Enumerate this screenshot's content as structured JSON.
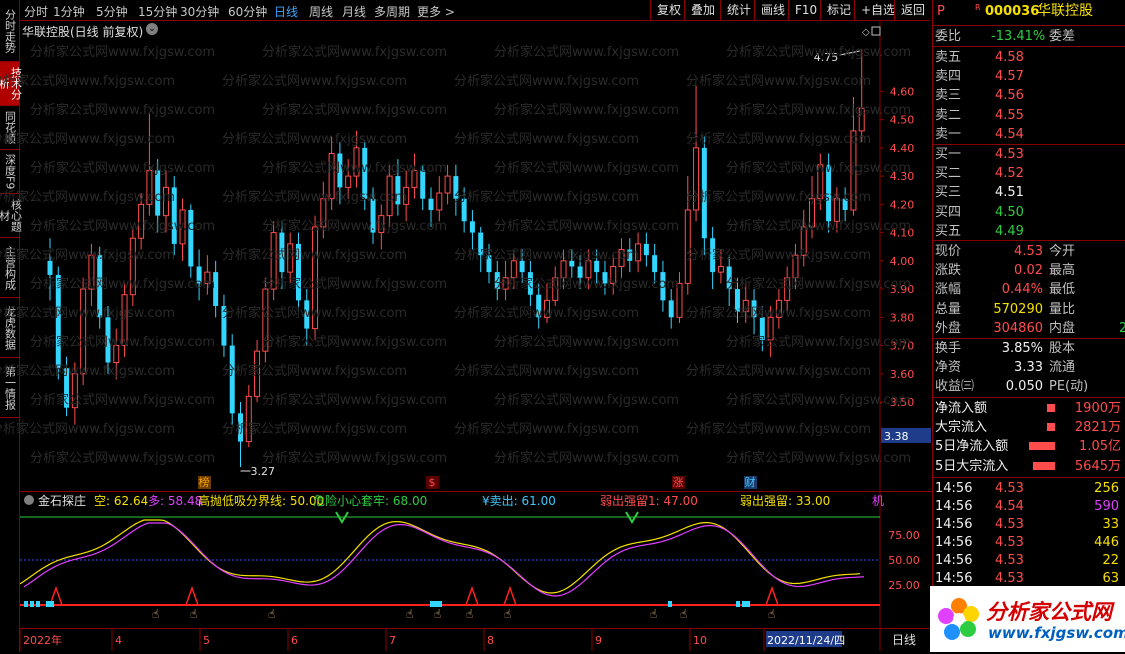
{
  "toolbar": {
    "timeframes": [
      "分时",
      "1分钟",
      "5分钟",
      "15分钟",
      "30分钟",
      "60分钟",
      "日线",
      "周线",
      "月线",
      "多周期",
      "更多 >"
    ],
    "active_timeframe": "日线",
    "buttons": [
      "复权",
      "叠加",
      "统计",
      "画线",
      "F10",
      "标记",
      "+自选",
      "返回"
    ]
  },
  "left_tabs": [
    "分时走势",
    "技术分析",
    "同花顺",
    "深度F9",
    "核心题材",
    "主营构成",
    "龙虎数据",
    "第一情报"
  ],
  "active_left_tab": "技术分析",
  "main_chart": {
    "title": "华联控股(日线 前复权)",
    "price_labels": [
      "4.60",
      "4.50",
      "4.40",
      "4.30",
      "4.20",
      "4.10",
      "4.00",
      "3.90",
      "3.80",
      "3.70",
      "3.60",
      "3.50"
    ],
    "current_price_tag": "3.38",
    "high_annotation": "4.75",
    "low_annotation": "3.27",
    "event_markers": [
      "榜",
      "$",
      "涨",
      "财"
    ],
    "watermark": "分析家公式网www.fxjgsw.com"
  },
  "chart_data": {
    "type": "candlestick",
    "title": "华联控股(日线 前复权)",
    "ylim": [
      3.27,
      4.75
    ],
    "x_ticks": [
      "2022年",
      "4",
      "5",
      "6",
      "7",
      "8",
      "9",
      "10",
      "2022/11/24/四"
    ],
    "candles": [
      [
        4.0,
        3.95,
        4.08,
        3.86
      ],
      [
        3.95,
        3.62,
        3.98,
        3.58
      ],
      [
        3.62,
        3.48,
        3.66,
        3.45
      ],
      [
        3.48,
        3.6,
        3.64,
        3.42
      ],
      [
        3.6,
        3.9,
        3.94,
        3.56
      ],
      [
        3.9,
        4.02,
        4.06,
        3.84
      ],
      [
        4.02,
        3.8,
        4.05,
        3.76
      ],
      [
        3.8,
        3.64,
        3.84,
        3.6
      ],
      [
        3.64,
        3.7,
        3.76,
        3.58
      ],
      [
        3.7,
        3.88,
        3.92,
        3.66
      ],
      [
        3.88,
        4.08,
        4.12,
        3.84
      ],
      [
        4.08,
        4.2,
        4.24,
        4.04
      ],
      [
        4.2,
        4.32,
        4.52,
        4.16
      ],
      [
        4.32,
        4.16,
        4.36,
        4.1
      ],
      [
        4.16,
        4.26,
        4.32,
        4.1
      ],
      [
        4.26,
        4.06,
        4.3,
        4.02
      ],
      [
        4.06,
        4.18,
        4.22,
        4.0
      ],
      [
        4.18,
        3.98,
        4.2,
        3.94
      ],
      [
        3.98,
        3.92,
        4.04,
        3.86
      ],
      [
        3.92,
        3.96,
        4.02,
        3.88
      ],
      [
        3.96,
        3.84,
        4.0,
        3.8
      ],
      [
        3.84,
        3.7,
        3.88,
        3.66
      ],
      [
        3.7,
        3.46,
        3.74,
        3.42
      ],
      [
        3.46,
        3.36,
        3.5,
        3.27
      ],
      [
        3.36,
        3.52,
        3.56,
        3.34
      ],
      [
        3.52,
        3.68,
        3.72,
        3.5
      ],
      [
        3.68,
        3.9,
        3.94,
        3.64
      ],
      [
        3.9,
        4.1,
        4.14,
        3.86
      ],
      [
        4.1,
        3.96,
        4.14,
        3.9
      ],
      [
        3.96,
        4.06,
        4.1,
        3.92
      ],
      [
        4.06,
        3.86,
        4.1,
        3.82
      ],
      [
        3.86,
        3.76,
        3.9,
        3.7
      ],
      [
        3.76,
        4.12,
        4.16,
        3.72
      ],
      [
        4.12,
        4.22,
        4.28,
        4.08
      ],
      [
        4.22,
        4.38,
        4.44,
        4.18
      ],
      [
        4.38,
        4.26,
        4.42,
        4.2
      ],
      [
        4.26,
        4.3,
        4.36,
        4.22
      ],
      [
        4.3,
        4.4,
        4.46,
        4.26
      ],
      [
        4.4,
        4.22,
        4.42,
        4.18
      ],
      [
        4.22,
        4.1,
        4.26,
        4.06
      ],
      [
        4.1,
        4.16,
        4.2,
        4.04
      ],
      [
        4.16,
        4.3,
        4.34,
        4.12
      ],
      [
        4.3,
        4.2,
        4.36,
        4.16
      ],
      [
        4.2,
        4.26,
        4.32,
        4.14
      ],
      [
        4.26,
        4.32,
        4.38,
        4.22
      ],
      [
        4.32,
        4.22,
        4.34,
        4.18
      ],
      [
        4.22,
        4.18,
        4.26,
        4.12
      ],
      [
        4.18,
        4.24,
        4.3,
        4.14
      ],
      [
        4.24,
        4.3,
        4.34,
        4.2
      ],
      [
        4.3,
        4.22,
        4.34,
        4.16
      ],
      [
        4.22,
        4.14,
        4.26,
        4.1
      ],
      [
        4.14,
        4.1,
        4.18,
        4.04
      ],
      [
        4.1,
        4.02,
        4.12,
        3.96
      ],
      [
        4.02,
        3.96,
        4.06,
        3.92
      ],
      [
        3.96,
        3.9,
        4.0,
        3.86
      ],
      [
        3.9,
        3.94,
        4.0,
        3.86
      ],
      [
        3.94,
        4.0,
        4.04,
        3.9
      ],
      [
        4.0,
        3.96,
        4.04,
        3.92
      ],
      [
        3.96,
        3.88,
        4.0,
        3.84
      ],
      [
        3.88,
        3.8,
        3.92,
        3.76
      ],
      [
        3.8,
        3.86,
        3.92,
        3.78
      ],
      [
        3.86,
        3.94,
        3.98,
        3.84
      ],
      [
        3.94,
        4.0,
        4.04,
        3.9
      ],
      [
        4.0,
        3.98,
        4.04,
        3.94
      ],
      [
        3.98,
        3.94,
        4.02,
        3.9
      ],
      [
        3.94,
        4.0,
        4.04,
        3.9
      ],
      [
        4.0,
        3.96,
        4.04,
        3.92
      ],
      [
        3.96,
        3.92,
        4.0,
        3.88
      ],
      [
        3.92,
        3.98,
        4.02,
        3.88
      ],
      [
        3.98,
        4.04,
        4.08,
        3.94
      ],
      [
        4.04,
        4.0,
        4.08,
        3.96
      ],
      [
        4.0,
        4.06,
        4.1,
        3.96
      ],
      [
        4.06,
        4.02,
        4.1,
        3.98
      ],
      [
        4.02,
        3.96,
        4.06,
        3.92
      ],
      [
        3.96,
        3.86,
        4.0,
        3.82
      ],
      [
        3.86,
        3.8,
        3.9,
        3.76
      ],
      [
        3.8,
        3.92,
        3.96,
        3.78
      ],
      [
        3.92,
        4.18,
        4.3,
        3.88
      ],
      [
        4.18,
        4.4,
        4.62,
        4.14
      ],
      [
        4.4,
        4.08,
        4.44,
        4.02
      ],
      [
        4.08,
        3.96,
        4.12,
        3.9
      ],
      [
        3.96,
        3.98,
        4.04,
        3.92
      ],
      [
        3.98,
        3.9,
        4.02,
        3.84
      ],
      [
        3.9,
        3.82,
        3.94,
        3.78
      ],
      [
        3.82,
        3.86,
        3.92,
        3.78
      ],
      [
        3.86,
        3.8,
        3.9,
        3.74
      ],
      [
        3.8,
        3.72,
        3.84,
        3.68
      ],
      [
        3.72,
        3.8,
        3.84,
        3.66
      ],
      [
        3.8,
        3.86,
        3.9,
        3.76
      ],
      [
        3.86,
        3.94,
        3.98,
        3.82
      ],
      [
        3.94,
        4.02,
        4.06,
        3.9
      ],
      [
        4.02,
        4.12,
        4.18,
        3.98
      ],
      [
        4.12,
        4.22,
        4.3,
        4.08
      ],
      [
        4.22,
        4.34,
        4.38,
        4.18
      ],
      [
        4.34,
        4.14,
        4.38,
        4.1
      ],
      [
        4.14,
        4.22,
        4.26,
        4.1
      ],
      [
        4.22,
        4.18,
        4.26,
        4.14
      ],
      [
        4.18,
        4.46,
        4.58,
        4.16
      ],
      [
        4.46,
        4.54,
        4.75,
        4.42
      ]
    ]
  },
  "indicator": {
    "name": "金石探庄",
    "items": [
      {
        "label": "空: 62.64",
        "color": "#f5e000"
      },
      {
        "label": "多: 58.48",
        "color": "#e040ff"
      },
      {
        "label": "高抛低吸分界线: 50.00",
        "color": "#f5e000"
      },
      {
        "label": "危险小心套牢: 68.00",
        "color": "#2ecc40"
      },
      {
        "label": "¥卖出: 61.00",
        "color": "#3ec8ff"
      },
      {
        "label": "弱出强留1: 47.00",
        "color": "#ff4d4d"
      },
      {
        "label": "弱出强留: 33.00",
        "color": "#f5e000"
      }
    ],
    "overflow_label": "机",
    "y_labels": [
      "75.00",
      "50.00",
      "25.00"
    ]
  },
  "bottom": {
    "period_label": "日线",
    "date_highlight": "2022/11/24/四"
  },
  "quote": {
    "marker": "P",
    "code": "000036",
    "name": "华联控股",
    "weibi_label": "委比",
    "weibi_value": "-13.41%",
    "weicha_label": "委差",
    "sells": [
      {
        "label": "卖五",
        "price": "4.58"
      },
      {
        "label": "卖四",
        "price": "4.57"
      },
      {
        "label": "卖三",
        "price": "4.56"
      },
      {
        "label": "卖二",
        "price": "4.55"
      },
      {
        "label": "卖一",
        "price": "4.54"
      }
    ],
    "buys": [
      {
        "label": "买一",
        "price": "4.53",
        "color": "#ff4d4d"
      },
      {
        "label": "买二",
        "price": "4.52",
        "color": "#ff4d4d"
      },
      {
        "label": "买三",
        "price": "4.51",
        "color": "#f0f0f0"
      },
      {
        "label": "买四",
        "price": "4.50",
        "color": "#2ecc40"
      },
      {
        "label": "买五",
        "price": "4.49",
        "color": "#2ecc40"
      }
    ],
    "stats": [
      {
        "label": "现价",
        "value": "4.53",
        "label2": "今开",
        "color": "#ff4d4d"
      },
      {
        "label": "涨跌",
        "value": "0.02",
        "label2": "最高",
        "color": "#ff4d4d"
      },
      {
        "label": "涨幅",
        "value": "0.44%",
        "label2": "最低",
        "color": "#ff4d4d"
      },
      {
        "label": "总量",
        "value": "570290",
        "label2": "量比",
        "color": "#f5e000"
      },
      {
        "label": "外盘",
        "value": "304860",
        "label2": "内盘",
        "color": "#ff4d4d",
        "extra": "2"
      }
    ],
    "stats2": [
      {
        "label": "换手",
        "value": "3.85%",
        "label2": "股本"
      },
      {
        "label": "净资",
        "value": "3.33",
        "label2": "流通"
      },
      {
        "label": "收益㈢",
        "value": "0.050",
        "label2": "PE(动)"
      }
    ],
    "flows": [
      {
        "label": "净流入额",
        "value": "1900万",
        "bar": 8
      },
      {
        "label": "大宗流入",
        "value": "2821万",
        "bar": 8
      },
      {
        "label": "5日净流入额",
        "value": "1.05亿",
        "bar": 26
      },
      {
        "label": "5日大宗流入",
        "value": "5645万",
        "bar": 22
      }
    ],
    "ticks": [
      {
        "time": "14:56",
        "price": "4.53",
        "vol": "256",
        "vcolor": "#f5e000"
      },
      {
        "time": "14:56",
        "price": "4.54",
        "vol": "590",
        "vcolor": "#e040ff"
      },
      {
        "time": "14:56",
        "price": "4.53",
        "vol": "33",
        "vcolor": "#f5e000"
      },
      {
        "time": "14:56",
        "price": "4.53",
        "vol": "446",
        "vcolor": "#f5e000"
      },
      {
        "time": "14:56",
        "price": "4.53",
        "vol": "22",
        "vcolor": "#f5e000"
      },
      {
        "time": "14:56",
        "price": "4.53",
        "vol": "63",
        "vcolor": "#f5e000"
      },
      {
        "time": "14:56",
        "price": "4.53",
        "vol": "7",
        "vcolor": "#f5e000"
      }
    ]
  },
  "logo": {
    "title": "分析家公式网",
    "url": "www.fxjgsw.com"
  }
}
